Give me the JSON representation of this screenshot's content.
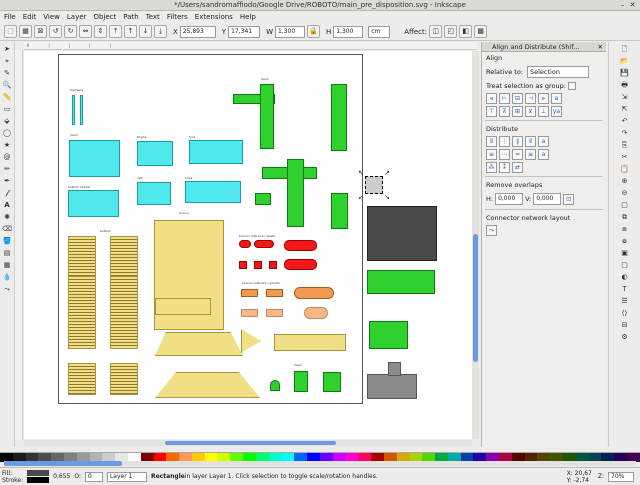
{
  "window": {
    "title": "*/Users/sandromaffiodo/Google Drive/ROBOTO/main_pre_disposition.svg - Inkscape"
  },
  "menu": [
    "File",
    "Edit",
    "View",
    "Layer",
    "Object",
    "Path",
    "Text",
    "Filters",
    "Extensions",
    "Help"
  ],
  "toolbar": {
    "x_label": "X",
    "x_value": "25,893",
    "y_label": "Y",
    "y_value": "17,341",
    "w_label": "W",
    "w_value": "1,300",
    "h_label": "H",
    "h_value": "1,300",
    "unit": "cm",
    "affect_label": "Affect:"
  },
  "dock": {
    "title": "Align and Distribute (Shif...",
    "align_heading": "Align",
    "relative_label": "Relative to:",
    "relative_value": "Selection",
    "group_label": "Treat selection as group:",
    "distribute_heading": "Distribute",
    "overlap_heading": "Remove overlaps",
    "h_label": "H:",
    "h_value": "0,000",
    "v_label": "V:",
    "v_value": "0,000",
    "connector_heading": "Connector network layout"
  },
  "canvas_labels": {
    "hand_l": "hip/hand",
    "hand_r": "hand",
    "thighs": "thighs",
    "foot_l": "foot",
    "foot_r": "half",
    "bottom": "bottom header",
    "calf": "calf",
    "knee": "knee",
    "tronco": "tronco",
    "bracc": "braccio inferiore / spalle",
    "bracc2": "braccio inferiore / gomito",
    "bottom2": "bottom",
    "shaft": "shaft",
    "head": "head"
  },
  "palette": [
    "#000000",
    "#1a1a1a",
    "#333333",
    "#4d4d4d",
    "#666666",
    "#808080",
    "#999999",
    "#b3b3b3",
    "#cccccc",
    "#e6e6e6",
    "#ffffff",
    "#800000",
    "#ff0000",
    "#ff6600",
    "#ff9955",
    "#ffcc00",
    "#ffff00",
    "#ccff00",
    "#66ff00",
    "#00ff00",
    "#00ff66",
    "#00ffcc",
    "#00ffff",
    "#0066ff",
    "#0000ff",
    "#6600ff",
    "#cc00ff",
    "#ff00cc",
    "#ff0066",
    "#aa0000",
    "#d45500",
    "#d4aa00",
    "#aad400",
    "#55d400",
    "#00aa44",
    "#00aaaa",
    "#0044aa",
    "#2200aa",
    "#8800aa",
    "#aa0044",
    "#550000",
    "#552200",
    "#554400",
    "#445500",
    "#225500",
    "#005544",
    "#004455",
    "#002255",
    "#220055",
    "#440055"
  ],
  "status": {
    "fill_label": "Fill:",
    "stroke_label": "Stroke:",
    "stroke_value": "0,655",
    "opacity_label": "O:",
    "opacity_value": "0",
    "layer": "Layer 1",
    "message_strong": "Rectangle",
    "message": " in layer Layer 1. Click selection to toggle scale/rotation handles.",
    "coord_x": "X: 20,67",
    "coord_y": "Y: -2,74",
    "zoom_label": "Z:",
    "zoom": "70%"
  }
}
